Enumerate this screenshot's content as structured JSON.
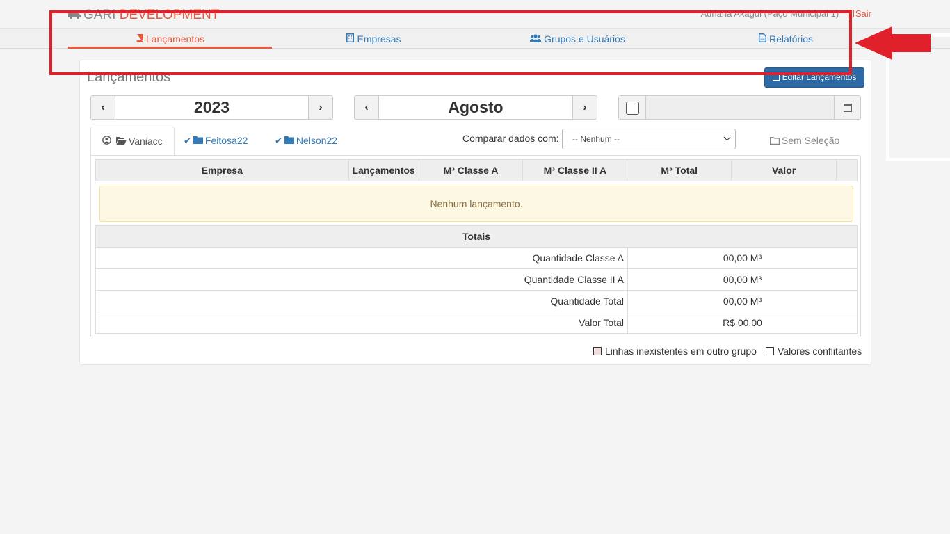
{
  "header": {
    "brand_prefix": "GARI",
    "brand_accent": "DEVELOPMENT",
    "user_info": "Adriana Akagui (Paço Municipal 1)",
    "logout_label": "Sair"
  },
  "nav": {
    "tabs": [
      {
        "label": "Lançamentos",
        "icon": "book-icon"
      },
      {
        "label": "Empresas",
        "icon": "building-icon"
      },
      {
        "label": "Grupos e Usuários",
        "icon": "users-icon"
      },
      {
        "label": "Relatórios",
        "icon": "file-text-icon"
      }
    ],
    "active_index": 0
  },
  "panel": {
    "title": "Lançamentos",
    "edit_button": "Editar Lançamentos",
    "year": "2023",
    "month": "Agosto",
    "date_value": ""
  },
  "tabs": {
    "items": [
      "Vaniacc",
      "Feitosa22",
      "Nelson22"
    ],
    "compare_label": "Comparar dados com:",
    "compare_selected": "-- Nenhum --",
    "no_selection": "Sem Seleção"
  },
  "table": {
    "columns": [
      "Empresa",
      "Lançamentos",
      "M³ Classe A",
      "M³ Classe II A",
      "M³ Total",
      "Valor"
    ],
    "empty_message": "Nenhum lançamento.",
    "totals_title": "Totais",
    "totals": [
      {
        "label": "Quantidade Classe A",
        "value": "00,00 M³"
      },
      {
        "label": "Quantidade Classe II A",
        "value": "00,00 M³"
      },
      {
        "label": "Quantidade Total",
        "value": "00,00 M³"
      },
      {
        "label": "Valor Total",
        "value": "R$ 00,00"
      }
    ]
  },
  "legend": {
    "missing_rows": "Linhas inexistentes em outro grupo",
    "conflicts": "Valores conflitantes"
  },
  "colors": {
    "accent": "#e8573c",
    "link": "#337ab7",
    "annotation": "#e0202a",
    "primary_button": "#2d6aa5",
    "missing_rows_swatch": "#f2dede",
    "conflicts_swatch": "#ffffff"
  }
}
